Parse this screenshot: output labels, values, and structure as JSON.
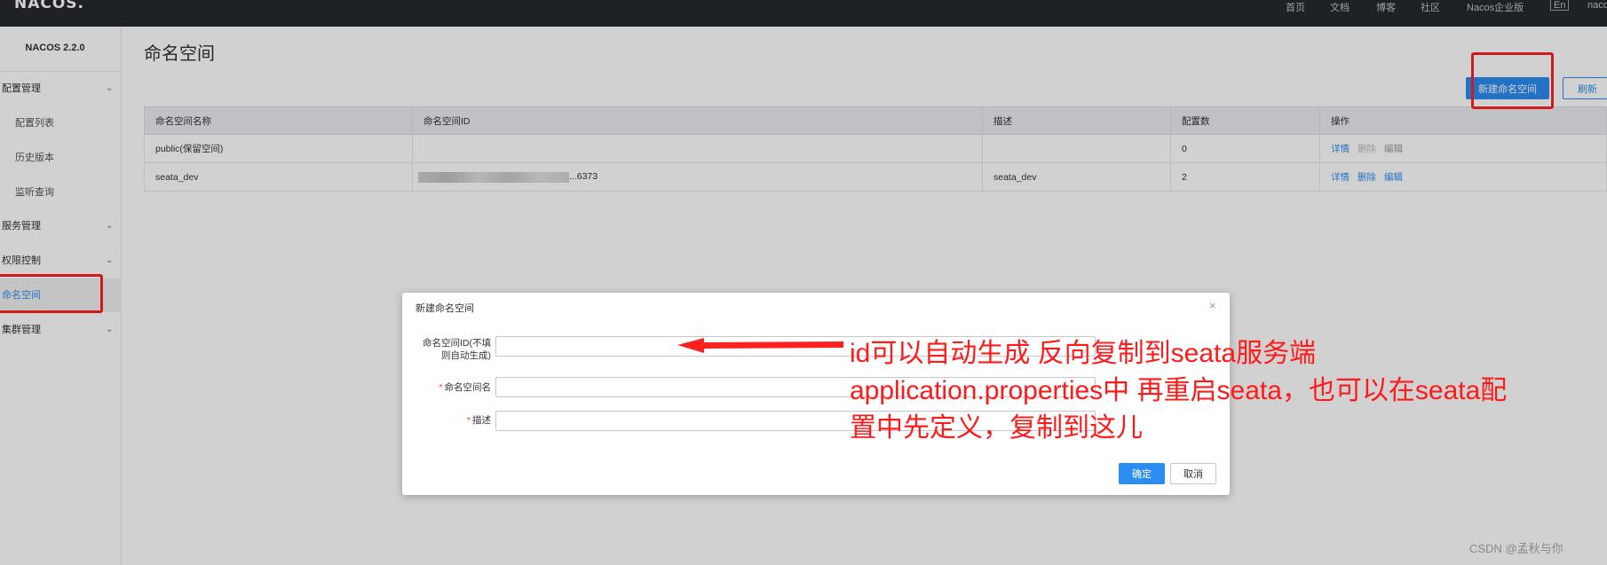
{
  "topnav": {
    "logo": "NACOS.",
    "items": [
      "首页",
      "文档",
      "博客",
      "社区",
      "Nacos企业版",
      "En",
      "nacos"
    ]
  },
  "sidebar": {
    "version": "NACOS 2.2.0",
    "items": [
      {
        "label": "配置管理",
        "type": "group",
        "expanded": true
      },
      {
        "label": "配置列表",
        "type": "sub"
      },
      {
        "label": "历史版本",
        "type": "sub"
      },
      {
        "label": "监听查询",
        "type": "sub"
      },
      {
        "label": "服务管理",
        "type": "group"
      },
      {
        "label": "权限控制",
        "type": "group"
      },
      {
        "label": "命名空间",
        "type": "item",
        "active": true
      },
      {
        "label": "集群管理",
        "type": "group"
      }
    ]
  },
  "main": {
    "title": "命名空间",
    "new_button": "新建命名空间",
    "refresh_button": "刷新",
    "table": {
      "headers": [
        "命名空间名称",
        "命名空间ID",
        "描述",
        "配置数",
        "操作"
      ],
      "rows": [
        {
          "name": "public(保留空间)",
          "id": "",
          "desc": "",
          "count": "0",
          "ops": [
            "详情",
            "删除",
            "编辑"
          ]
        },
        {
          "name": "seata_dev",
          "id": "...6373",
          "desc": "seata_dev",
          "count": "2",
          "ops": [
            "详情",
            "删除",
            "编辑"
          ]
        }
      ]
    }
  },
  "dialog": {
    "title": "新建命名空间",
    "close": "×",
    "fields": [
      {
        "label": "命名空间ID(不填则自动生成)",
        "label_line1": "命名空间ID(不填",
        "label_line2": "则自动生成)",
        "required": false,
        "value": "",
        "placeholder": ""
      },
      {
        "label": "命名空间名",
        "required": true,
        "value": "",
        "placeholder": ""
      },
      {
        "label": "描述",
        "required": true,
        "value": "",
        "placeholder": ""
      }
    ],
    "required_mark": "*",
    "confirm_button": "确定",
    "cancel_button": "取消"
  },
  "annotation": {
    "line1": "id可以自动生成 反向复制到seata服务端",
    "line2": "application.properties中 再重启seata，也可以在seata配",
    "line3": "置中先定义，复制到这儿",
    "color": "#ff1a1a"
  },
  "watermark": "CSDN @孟秋与你",
  "colors": {
    "primary": "#2d8cf0",
    "topnav_bg": "#252a2f",
    "annotation_red": "#ff2020"
  }
}
